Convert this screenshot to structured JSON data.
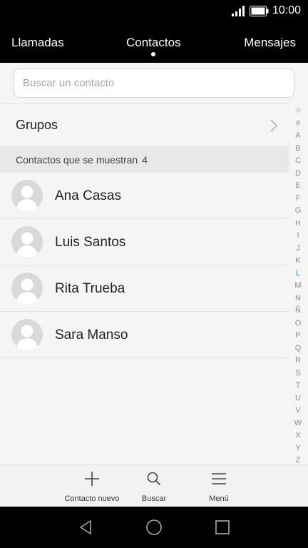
{
  "status_bar": {
    "time": "10:00",
    "signal_icon": "signal-icon",
    "battery_icon": "battery-icon"
  },
  "tabs": [
    {
      "label": "Llamadas",
      "active": false
    },
    {
      "label": "Contactos",
      "active": true
    },
    {
      "label": "Mensajes",
      "active": false
    }
  ],
  "search": {
    "placeholder": "Buscar un contacto",
    "value": ""
  },
  "groups": {
    "label": "Grupos"
  },
  "section": {
    "label": "Contactos que se muestran",
    "count": "4"
  },
  "contacts": [
    {
      "name": "Ana Casas"
    },
    {
      "name": "Luis Santos"
    },
    {
      "name": "Rita Trueba"
    },
    {
      "name": "Sara Manso"
    }
  ],
  "alpha_index": [
    "☆",
    "#",
    "A",
    "B",
    "C",
    "D",
    "E",
    "F",
    "G",
    "H",
    "I",
    "J",
    "K",
    "L",
    "M",
    "N",
    "Ñ",
    "O",
    "P",
    "Q",
    "R",
    "S",
    "T",
    "U",
    "V",
    "W",
    "X",
    "Y",
    "Z"
  ],
  "alpha_active": "L",
  "bottom_actions": [
    {
      "label": "Contacto nuevo",
      "icon": "plus-icon"
    },
    {
      "label": "Buscar",
      "icon": "search-icon"
    },
    {
      "label": "Menú",
      "icon": "menu-icon"
    }
  ],
  "colors": {
    "accent": "#19a0a0",
    "bar_background": "#000000"
  }
}
